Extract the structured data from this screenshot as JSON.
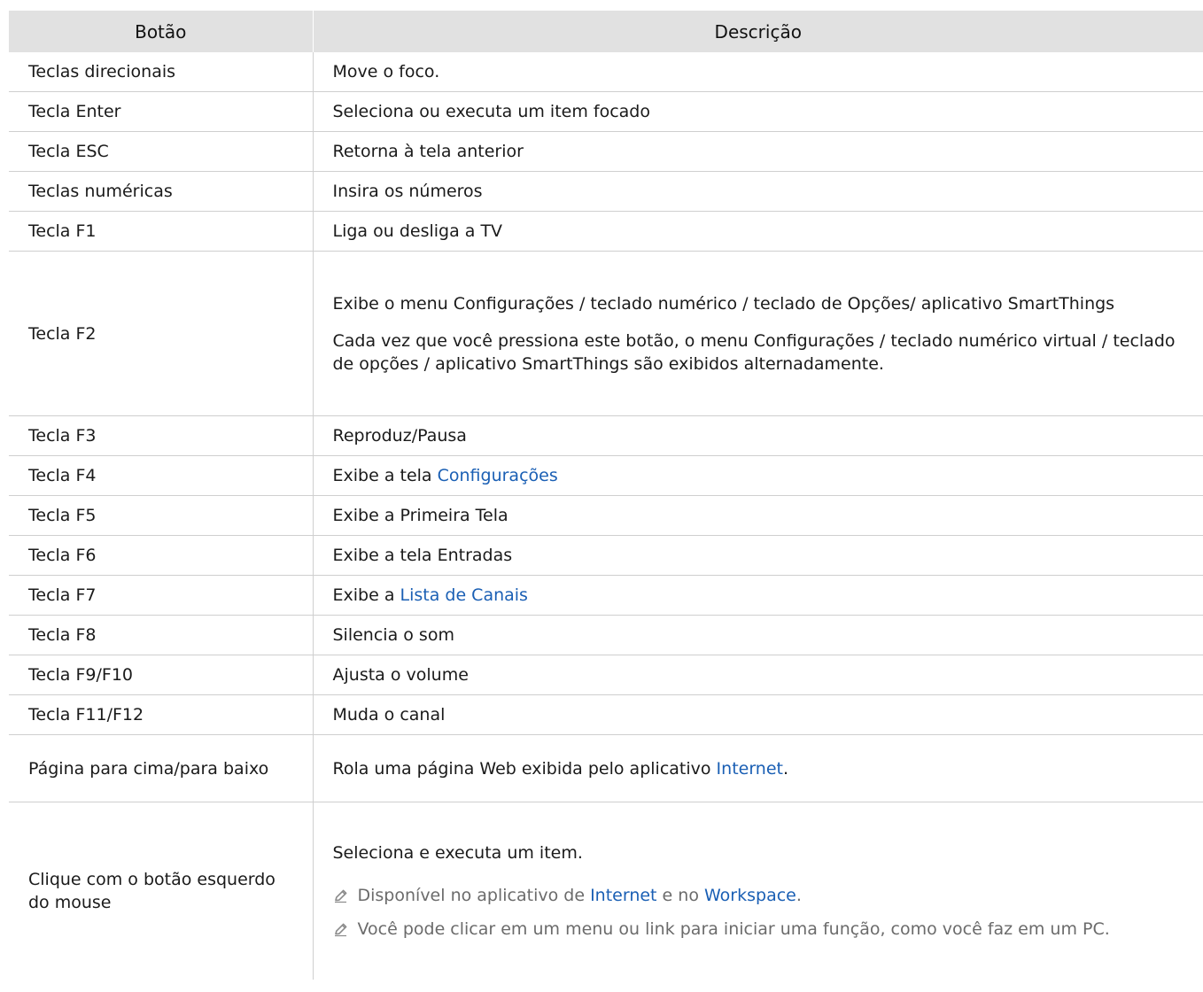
{
  "table": {
    "headers": [
      "Botão",
      "Descrição"
    ],
    "rows": [
      {
        "key": "Teclas direcionais",
        "desc": "Move o foco."
      },
      {
        "key": "Tecla Enter",
        "desc": "Seleciona ou executa um item focado"
      },
      {
        "key": "Tecla ESC",
        "desc": "Retorna à tela anterior"
      },
      {
        "key": "Teclas numéricas",
        "desc": "Insira os números"
      },
      {
        "key": "Tecla F1",
        "desc": "Liga ou desliga a TV"
      },
      {
        "key": "Tecla F2",
        "desc_p1": "Exibe o menu Configurações / teclado numérico / teclado de Opções/ aplicativo SmartThings",
        "desc_p2": "Cada vez que você pressiona este botão, o menu Configurações / teclado numérico virtual / teclado de opções / aplicativo SmartThings são exibidos alternadamente."
      },
      {
        "key": "Tecla F3",
        "desc": "Reproduz/Pausa"
      },
      {
        "key": "Tecla F4",
        "desc_pre": "Exibe a tela ",
        "desc_link": "Configurações"
      },
      {
        "key": "Tecla F5",
        "desc": "Exibe a Primeira Tela"
      },
      {
        "key": "Tecla F6",
        "desc": "Exibe a tela Entradas"
      },
      {
        "key": "Tecla F7",
        "desc_pre": "Exibe a ",
        "desc_link": "Lista de Canais"
      },
      {
        "key": "Tecla F8",
        "desc": "Silencia o som"
      },
      {
        "key": "Tecla F9/F10",
        "desc": "Ajusta o volume"
      },
      {
        "key": "Tecla F11/F12",
        "desc": "Muda o canal"
      },
      {
        "key": "Página para cima/para baixo",
        "desc_pre": "Rola uma página Web exibida pelo aplicativo ",
        "desc_link": "Internet",
        "desc_post": "."
      },
      {
        "key": "Clique com o botão esquerdo do mouse",
        "desc": "Seleciona e executa um item.",
        "note1_pre": "Disponível no aplicativo de ",
        "note1_link1": "Internet",
        "note1_mid": " e no ",
        "note1_link2": "Workspace",
        "note1_post": ".",
        "note2": "Você pode clicar em um menu ou link para iniciar uma função, como você faz em um PC."
      }
    ]
  },
  "colors": {
    "header_bg": "#e1e1e1",
    "link": "#1a5fb4",
    "note_text": "#6b6b6b",
    "border": "#cfcfcf"
  },
  "icons": {
    "note": "pencil-icon"
  }
}
